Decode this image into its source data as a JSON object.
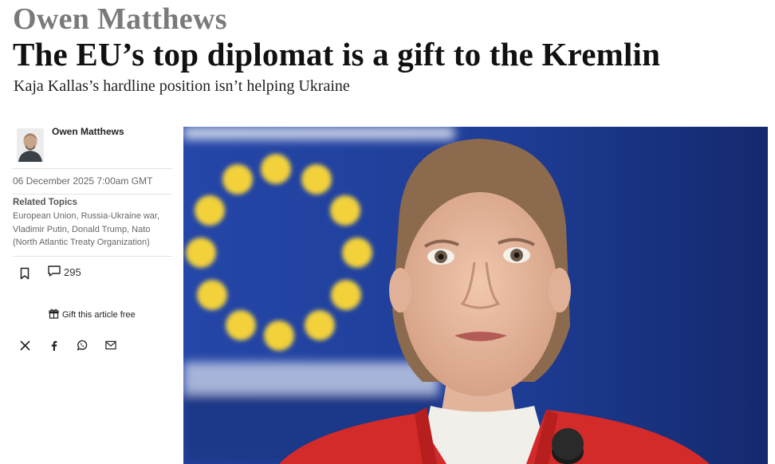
{
  "article": {
    "kicker": "Owen Matthews",
    "headline": "The EU’s top diplomat is a gift to the Kremlin",
    "standfirst": "Kaja Kallas’s hardline position isn’t helping Ukraine"
  },
  "byline": {
    "author": "Owen Matthews",
    "date": "06 December 2025 7:00am GMT"
  },
  "topics": {
    "title": "Related Topics",
    "list": "European Union, Russia-Ukraine war, Vladimir Putin, Donald Trump, Nato (North Atlantic Treaty Organization)"
  },
  "actions": {
    "comment_count": "295",
    "gift_label": "Gift this article free"
  },
  "icons": {
    "bookmark": "bookmark-icon",
    "comment": "comment-icon",
    "gift": "gift-icon",
    "share": [
      "x-icon",
      "facebook-icon",
      "whatsapp-icon",
      "email-icon"
    ]
  },
  "colors": {
    "kicker": "#7a7a7a",
    "eu_blue": "#1f3f9a",
    "eu_star": "#f2d13a",
    "jacket": "#d32a2a"
  }
}
